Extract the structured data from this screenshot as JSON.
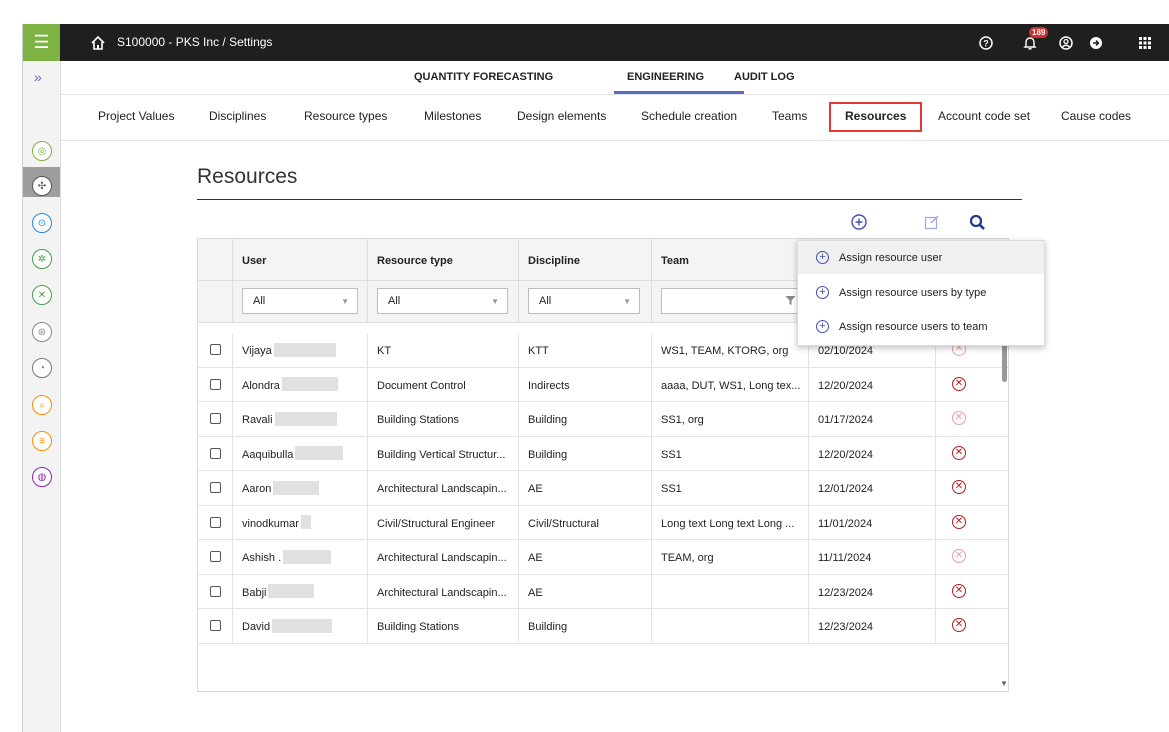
{
  "topbar": {
    "menu_icon": "hamburger-icon",
    "breadcrumb": "S100000 - PKS Inc  /  Settings",
    "notification_count": "189",
    "icons": [
      "help-icon",
      "bell-icon",
      "user-icon",
      "logout-icon",
      "apps-icon"
    ]
  },
  "subnav": {
    "items": [
      "QUANTITY FORECASTING",
      "ENGINEERING",
      "AUDIT LOG"
    ],
    "active": "ENGINEERING"
  },
  "tabs": {
    "items": [
      "Project Values",
      "Disciplines",
      "Resource types",
      "Milestones",
      "Design elements",
      "Schedule creation",
      "Teams",
      "Resources",
      "Account code set",
      "Cause codes"
    ],
    "active": "Resources"
  },
  "page": {
    "title": "Resources"
  },
  "grid": {
    "columns": [
      "User",
      "Resource type",
      "Discipline",
      "Team"
    ],
    "filters": {
      "user": "All",
      "resource_type": "All",
      "discipline": "All",
      "team": ""
    },
    "rows": [
      {
        "user": "Vijaya",
        "resource_type": "KT",
        "discipline": "KTT",
        "team": "WS1, TEAM, KTORG, org",
        "date": "02/10/2024",
        "deletable": false
      },
      {
        "user": "Alondra",
        "resource_type": "Document Control",
        "discipline": "Indirects",
        "team": "aaaa, DUT, WS1, Long tex...",
        "date": "12/20/2024",
        "deletable": true
      },
      {
        "user": "Ravali",
        "resource_type": "Building Stations",
        "discipline": "Building",
        "team": "SS1, org",
        "date": "01/17/2024",
        "deletable": false
      },
      {
        "user": "Aaquibulla",
        "resource_type": "Building Vertical Structur...",
        "discipline": "Building",
        "team": "SS1",
        "date": "12/20/2024",
        "deletable": true
      },
      {
        "user": "Aaron",
        "resource_type": "Architectural Landscapin...",
        "discipline": "AE",
        "team": "SS1",
        "date": "12/01/2024",
        "deletable": true
      },
      {
        "user": "vinodkumar",
        "resource_type": "Civil/Structural Engineer",
        "discipline": "Civil/Structural",
        "team": "Long text Long text Long ...",
        "date": "11/01/2024",
        "deletable": true
      },
      {
        "user": "Ashish .",
        "resource_type": "Architectural Landscapin...",
        "discipline": "AE",
        "team": "TEAM, org",
        "date": "11/11/2024",
        "deletable": false
      },
      {
        "user": "Babji",
        "resource_type": "Architectural Landscapin...",
        "discipline": "AE",
        "team": "",
        "date": "12/23/2024",
        "deletable": true
      },
      {
        "user": "David",
        "resource_type": "Building Stations",
        "discipline": "Building",
        "team": "",
        "date": "12/23/2024",
        "deletable": true
      }
    ]
  },
  "menu": {
    "items": [
      "Assign resource user",
      "Assign resource users by type",
      "Assign resource users to team"
    ]
  },
  "colors": {
    "accent": "#7cb342",
    "primary": "#3f51b5",
    "danger": "#b71c1c",
    "highlight": "#e53935"
  }
}
